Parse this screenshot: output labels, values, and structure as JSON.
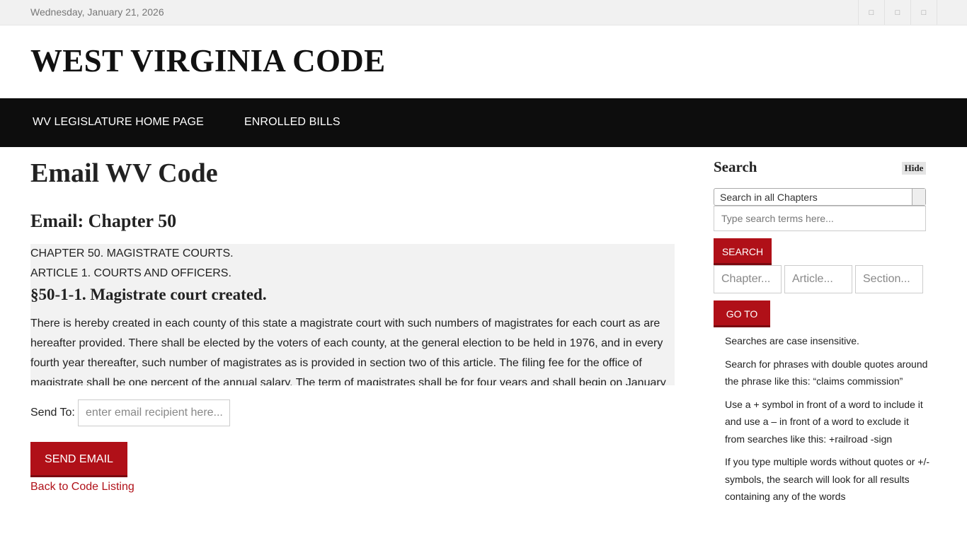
{
  "topbar": {
    "date": "Wednesday, January 21, 2026",
    "social_icons": [
      "social-icon",
      "social-icon",
      "social-icon"
    ],
    "social_glyph": "□"
  },
  "header": {
    "site_title": "WEST VIRGINIA CODE"
  },
  "nav": {
    "items": [
      {
        "label": "WV LEGISLATURE HOME PAGE"
      },
      {
        "label": "ENROLLED BILLS"
      }
    ]
  },
  "main": {
    "title": "Email WV Code",
    "subtitle": "Email: Chapter 50",
    "code": {
      "chapter": "CHAPTER 50. MAGISTRATE COURTS.",
      "article": "ARTICLE 1. COURTS AND OFFICERS.",
      "section_title": "§50-1-1. Magistrate court created.",
      "body": "There is hereby created in each county of this state a magistrate court with such numbers of magistrates for each court as are hereafter provided. There shall be elected by the voters of each county, at the general election to be held in 1976, and in every fourth year thereafter, such number of magistrates as is provided in section two of this article. The filing fee for the office of magistrate shall be one percent of the annual salary. The term of magistrates shall be for four years and shall begin on January"
    },
    "send_to_label": "Send To:",
    "email_placeholder": "enter email recipient here...",
    "send_button": "SEND EMAIL",
    "back_link": "Back to Code Listing"
  },
  "sidebar": {
    "heading": "Search",
    "hide_button": "Hide",
    "scope_select": "Search in all Chapters",
    "search_placeholder": "Type search terms here...",
    "search_button": "SEARCH",
    "chapter_placeholder": "Chapter...",
    "article_placeholder": "Article...",
    "section_placeholder": "Section...",
    "goto_button": "GO TO",
    "tips": [
      "Searches are case insensitive.",
      "Search for phrases with double quotes around the phrase like this: “claims commission”",
      "Use a + symbol in front of a word to include it and use a – in front of a word to exclude it from searches like this: +railroad -sign",
      "If you type multiple words without quotes or +/- symbols, the search will look for all results containing any of the words"
    ]
  },
  "colors": {
    "accent": "#b01018",
    "navbar": "#0d0d0d",
    "topbar": "#f1f1f1",
    "code_box": "#f2f2f2"
  }
}
